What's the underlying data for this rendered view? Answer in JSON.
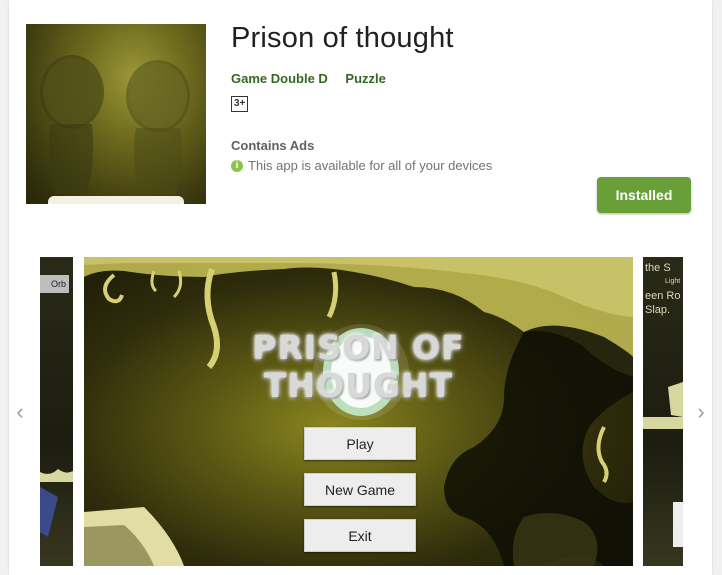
{
  "app": {
    "title": "Prison of thought",
    "developer": "Game Double D",
    "genre": "Puzzle",
    "rating": "3+",
    "contains_ads": "Contains Ads",
    "availability": "This app is available for all of your devices",
    "install_label": "Installed"
  },
  "screenshots": {
    "left_partial_label": "Orb",
    "right_partial_lines": [
      "the S",
      "Light",
      "een Ro",
      "Slap."
    ],
    "main": {
      "game_title_line1": "PRISON OF",
      "game_title_line2": "THOUGHT",
      "buttons": [
        "Play",
        "New Game",
        "Exit"
      ]
    }
  },
  "colors": {
    "accent_green": "#689f38",
    "meta_green": "#33691e",
    "info_icon_green": "#8bc34a"
  },
  "icons": {
    "info": "info-icon",
    "carousel_prev": "chevron-left-icon",
    "carousel_next": "chevron-right-icon"
  }
}
